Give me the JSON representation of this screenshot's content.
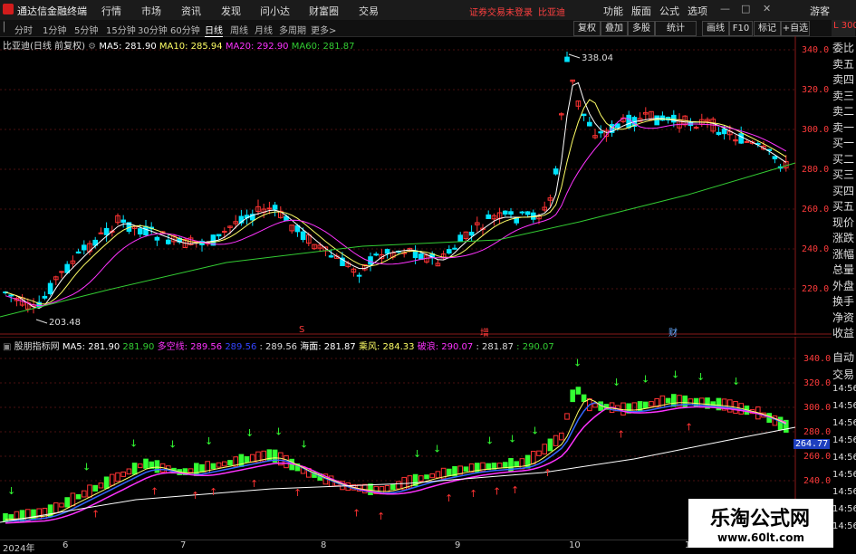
{
  "app": {
    "title": "通达信金融终端",
    "menu": [
      "行情",
      "市场",
      "资讯",
      "发现",
      "问小达",
      "财富圈",
      "交易"
    ],
    "notice": "证券交易未登录",
    "stock_name": "比亚迪",
    "right_menu": [
      "功能",
      "版面",
      "公式",
      "选项"
    ],
    "guest": "游客",
    "window_controls": [
      "minimize-icon",
      "restore-icon",
      "close-icon"
    ]
  },
  "toolbar": {
    "periods": [
      "分时",
      "1分钟",
      "5分钟",
      "15分钟",
      "30分钟",
      "60分钟",
      "日线",
      "周线",
      "月线",
      "多周期",
      "更多>"
    ],
    "active_period": "日线",
    "right_buttons": [
      "复权",
      "叠加",
      "多股",
      "统计",
      "画线",
      "F10",
      "标记",
      "+自选"
    ],
    "badge": "L 300"
  },
  "main_chart": {
    "header_name": "比亚迪(日线 前复权)",
    "ma5": "MA5: 281.90",
    "ma10": "MA10: 285.94",
    "ma20": "MA20: 292.90",
    "ma60": "MA60: 281.87",
    "high_label": "338.04",
    "low_label": "203.48",
    "axis": [
      "340.0",
      "320.0",
      "300.0",
      "280.0",
      "260.0",
      "240.0",
      "220.0"
    ],
    "markers": [
      "S",
      "增",
      "财"
    ]
  },
  "indicator": {
    "name": "股朋指标网",
    "ma5": "MA5: 281.90",
    "v1": "281.90",
    "duo": "多空线: 289.56",
    "v2": "289.56",
    "v3": ": 289.56",
    "hai": "海面: 281.87",
    "chengfeng": "乘风: 284.33",
    "polang": "破浪: 290.07",
    "v4": ": 281.87",
    "v5": ": 290.07",
    "axis": [
      "340.0",
      "320.0",
      "300.0",
      "280.0",
      "260.0",
      "240.0"
    ],
    "price_tag": "264.77"
  },
  "side_panel": {
    "top": [
      "委比",
      "卖五",
      "卖四",
      "卖三",
      "卖二",
      "卖一",
      "买一",
      "买二",
      "买三",
      "买四",
      "买五",
      "现价",
      "涨跌",
      "涨幅",
      "总量",
      "外盘",
      "换手",
      "净资",
      "收益"
    ],
    "bottom": [
      "自动",
      "交易",
      "14:56",
      "14:56",
      "14:56",
      "14:56",
      "14:56",
      "14:56",
      "14:56",
      "14:56",
      "14:56"
    ]
  },
  "dates": [
    "2024年",
    "6",
    "7",
    "8",
    "9",
    "10",
    "11"
  ],
  "watermark": {
    "title": "乐淘公式网",
    "url": "www.60lt.com"
  },
  "colors": {
    "up": "#ff3333",
    "down": "#00e5ff",
    "ma5": "#ffffff",
    "ma10": "#ffff66",
    "ma20": "#ff33ff",
    "ma60": "#33cc33"
  }
}
